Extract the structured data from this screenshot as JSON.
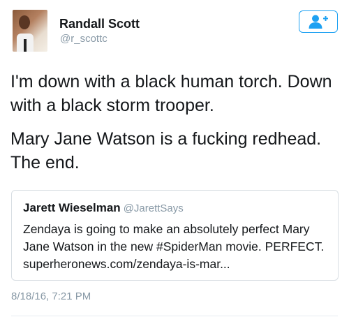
{
  "author": {
    "display_name": "Randall Scott",
    "handle": "@r_scottc"
  },
  "follow_button": {
    "icon": "add-user-icon",
    "color": "#1da1f2"
  },
  "tweet": {
    "paragraphs": [
      "I'm down with a black human torch. Down with a black storm trooper.",
      "Mary Jane Watson is a fucking redhead. The end."
    ],
    "timestamp": "8/18/16, 7:21 PM"
  },
  "quoted_tweet": {
    "display_name": "Jarett Wieselman",
    "handle": "@JarettSays",
    "text": "Zendaya is going to make an absolutely perfect Mary Jane Watson in the new #SpiderMan movie. PERFECT. superheronews.com/zendaya-is-mar..."
  }
}
